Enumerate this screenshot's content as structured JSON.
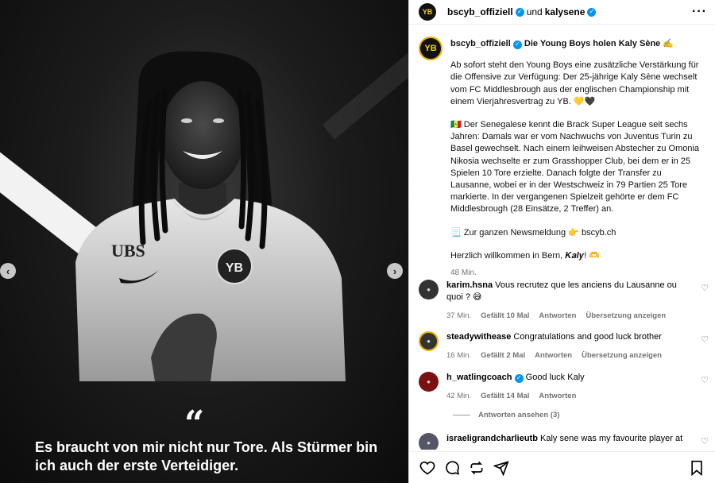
{
  "media": {
    "quote_mark": "“",
    "quote_text": "Es braucht von mir nicht nur Tore. Als Stürmer bin ich auch der erste Verteidiger.",
    "prev_icon": "chevron-left-icon",
    "next_icon": "chevron-right-icon",
    "shirt_sponsor": "UBS"
  },
  "header": {
    "author": "bscyb_offiziell",
    "collab_connector": "und",
    "collaborator": "kalysene",
    "avatar_text": "YB"
  },
  "caption": {
    "username": "bscyb_offiziell",
    "title": "Die Young Boys holen Kaly Sène ✍️",
    "para1": "Ab sofort steht den Young Boys eine zusätzliche Verstärkung für die Offensive zur Verfügung: Der 25-jährige Kaly Sène wechselt vom FC Middlesbrough aus der englischen Championship mit einem Vierjahresvertrag zu YB. 💛🖤",
    "para2": "🇸🇳 Der Senegalese kennt die Brack Super League seit sechs Jahren: Damals war er vom Nachwuchs von Juventus Turin zu Basel gewechselt. Nach einem leihweisen Abstecher zu Omonia Nikosia wechselte er zum Grasshopper Club, bei dem er in 25 Spielen 10 Tore erzielte. Danach folgte der Transfer zu Lausanne, wobei er in der Westschweiz in 79 Partien 25 Tore markierte. In der vergangenen Spielzeit gehörte er dem FC Middlesbrough (28 Einsätze, 2 Treffer) an.",
    "para3": "📃 Zur ganzen Newsmeldung 👉 bscyb.ch",
    "para4": "Herzlich willkommen in Bern, 𝑲𝒂𝒍𝒚! 🫶",
    "time": "48 Min."
  },
  "comments": [
    {
      "username": "karim.hsna",
      "text": "Vous recrutez que les anciens du Lausanne ou quoi ? 😅",
      "time": "37 Min.",
      "likes": "Gefällt 10 Mal",
      "reply": "Antworten",
      "translate": "Übersetzung anzeigen",
      "verified": false
    },
    {
      "username": "steadywithease",
      "text": "Congratulations and good luck brother",
      "time": "16 Min.",
      "likes": "Gefällt 2 Mal",
      "reply": "Antworten",
      "translate": "Übersetzung anzeigen",
      "verified": false
    },
    {
      "username": "h_watlingcoach",
      "text": "Good luck Kaly",
      "time": "42 Min.",
      "likes": "Gefällt 14 Mal",
      "reply": "Antworten",
      "translate": "",
      "verified": true
    },
    {
      "username": "israeligrandcharlieutb",
      "text": "Kaly sene was my favourite player at",
      "verified": false
    }
  ],
  "view_replies": "Antworten ansehen (3)",
  "actions": {
    "like_icon": "heart-icon",
    "comment_icon": "comment-icon",
    "repost_icon": "repost-icon",
    "share_icon": "share-icon",
    "save_icon": "bookmark-icon"
  }
}
